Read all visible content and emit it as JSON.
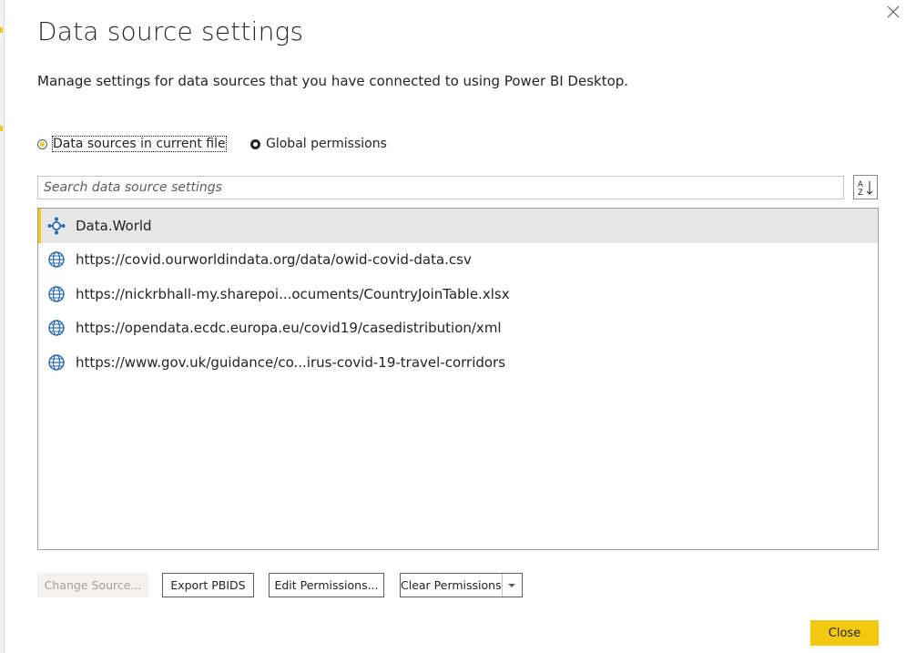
{
  "dialog": {
    "title": "Data source settings",
    "subtitle": "Manage settings for data sources that you have connected to using Power BI Desktop.",
    "close_icon": "close-icon"
  },
  "scope": {
    "options": [
      {
        "label": "Data sources in current file",
        "selected": true
      },
      {
        "label": "Global permissions",
        "selected": false
      }
    ]
  },
  "search": {
    "placeholder": "Search data source settings",
    "value": ""
  },
  "sort": {
    "icon": "sort-az-icon",
    "label_a": "A",
    "label_z": "Z"
  },
  "sources": [
    {
      "label": "Data.World",
      "icon": "connector-icon",
      "selected": true
    },
    {
      "label": "https://covid.ourworldindata.org/data/owid-covid-data.csv",
      "icon": "globe-icon",
      "selected": false
    },
    {
      "label": "https://nickrbhall-my.sharepoi...ocuments/CountryJoinTable.xlsx",
      "icon": "globe-icon",
      "selected": false
    },
    {
      "label": "https://opendata.ecdc.europa.eu/covid19/casedistribution/xml",
      "icon": "globe-icon",
      "selected": false
    },
    {
      "label": "https://www.gov.uk/guidance/co...irus-covid-19-travel-corridors",
      "icon": "globe-icon",
      "selected": false
    }
  ],
  "actions": {
    "change_source": "Change Source...",
    "export_pbids": "Export PBIDS",
    "edit_permissions": "Edit Permissions...",
    "clear_permissions": "Clear Permissions",
    "close": "Close"
  },
  "colors": {
    "accent": "#f2c811",
    "selected_row": "#e6e6e6",
    "icon_blue": "#2b6cb0"
  }
}
